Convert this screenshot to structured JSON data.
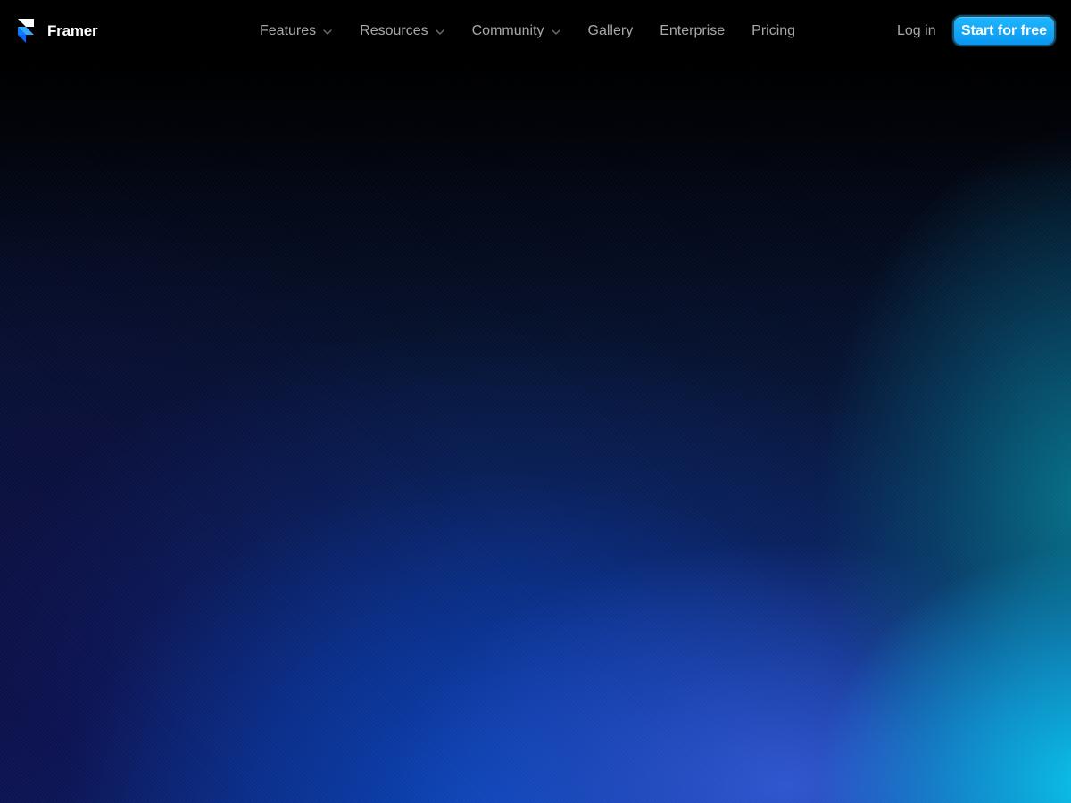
{
  "brand": {
    "name": "Framer",
    "logo_icon": "framer-logo-icon"
  },
  "nav": {
    "items": [
      {
        "label": "Features",
        "has_dropdown": true
      },
      {
        "label": "Resources",
        "has_dropdown": true
      },
      {
        "label": "Community",
        "has_dropdown": true
      },
      {
        "label": "Gallery",
        "has_dropdown": false
      },
      {
        "label": "Enterprise",
        "has_dropdown": false
      },
      {
        "label": "Pricing",
        "has_dropdown": false
      }
    ],
    "login_label": "Log in",
    "cta_label": "Start for free"
  },
  "colors": {
    "background": "#000000",
    "accent": "#0fa6f5",
    "nav_text": "#a8a8a8",
    "logo_white": "#ffffff",
    "logo_blue": "#0b99ff",
    "gradient_blue": "#0b3fa8",
    "gradient_cyan": "#08c8ee",
    "gradient_indigo": "#0e0638"
  }
}
